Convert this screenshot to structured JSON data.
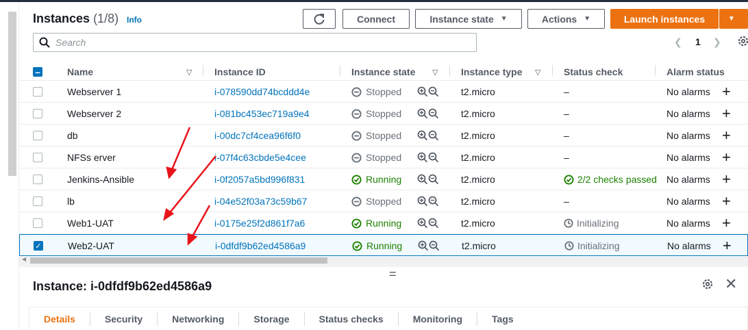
{
  "header": {
    "title": "Instances",
    "count": "(1/8)",
    "info": "Info",
    "refresh_icon": "refresh-icon",
    "connect": "Connect",
    "instance_state": "Instance state",
    "actions": "Actions",
    "launch": "Launch instances"
  },
  "search": {
    "placeholder": "Search"
  },
  "pager": {
    "page": "1"
  },
  "columns": {
    "name": "Name",
    "instance_id": "Instance ID",
    "instance_state": "Instance state",
    "instance_type": "Instance type",
    "status_check": "Status check",
    "alarm_status": "Alarm status"
  },
  "rows": [
    {
      "name": "Webserver 1",
      "id": "i-078590dd74bcddd4e",
      "state": "Stopped",
      "type": "t2.micro",
      "status": "–",
      "alarm": "No alarms",
      "checked": false
    },
    {
      "name": "Webserver 2",
      "id": "i-081bc453ec719a9e4",
      "state": "Stopped",
      "type": "t2.micro",
      "status": "–",
      "alarm": "No alarms",
      "checked": false
    },
    {
      "name": "db",
      "id": "i-00dc7cf4cea96f6f0",
      "state": "Stopped",
      "type": "t2.micro",
      "status": "–",
      "alarm": "No alarms",
      "checked": false
    },
    {
      "name": "NFSs erver",
      "id": "i-07f4c63cbde5e4cee",
      "state": "Stopped",
      "type": "t2.micro",
      "status": "–",
      "alarm": "No alarms",
      "checked": false
    },
    {
      "name": "Jenkins-Ansible",
      "id": "i-0f2057a5bd996f831",
      "state": "Running",
      "type": "t2.micro",
      "status": "2/2 checks passed",
      "alarm": "No alarms",
      "checked": false
    },
    {
      "name": "lb",
      "id": "i-04e52f03a73c59b67",
      "state": "Stopped",
      "type": "t2.micro",
      "status": "–",
      "alarm": "No alarms",
      "checked": false
    },
    {
      "name": "Web1-UAT",
      "id": "i-0175e25f2d861f7a6",
      "state": "Running",
      "type": "t2.micro",
      "status": "Initializing",
      "alarm": "No alarms",
      "checked": false
    },
    {
      "name": "Web2-UAT",
      "id": "i-0dfdf9b62ed4586a9",
      "state": "Running",
      "type": "t2.micro",
      "status": "Initializing",
      "alarm": "No alarms",
      "checked": true
    }
  ],
  "details": {
    "title": "Instance: i-0dfdf9b62ed4586a9",
    "tabs": [
      "Details",
      "Security",
      "Networking",
      "Storage",
      "Status checks",
      "Monitoring",
      "Tags"
    ]
  },
  "colors": {
    "primary": "#ec7211",
    "link": "#0073bb",
    "running": "#1d8102",
    "arrow": "#e8141a"
  }
}
